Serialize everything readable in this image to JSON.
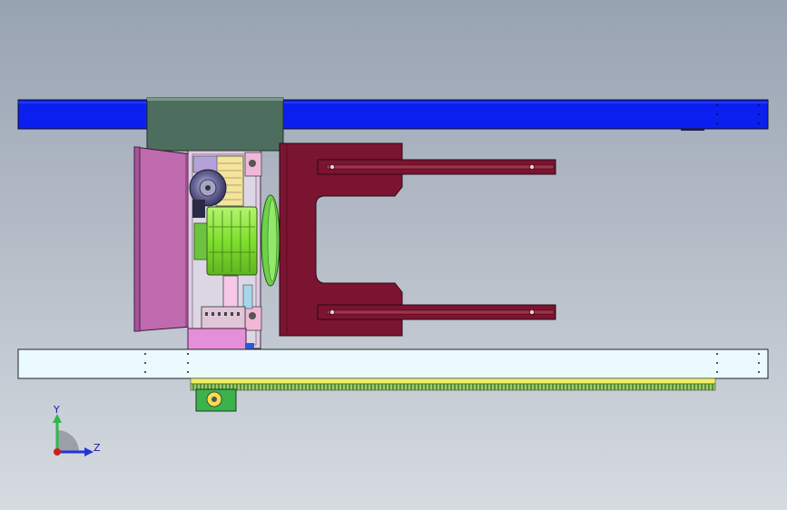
{
  "viewport": {
    "background_top": "#98a3b2",
    "background_bottom": "#d6dbe1"
  },
  "model": {
    "colors": {
      "top_beam": "#0a1ff0",
      "bottom_beam": "#eafafd",
      "carriage_dark_green": "#4d6e5e",
      "hopper": "#c06ab0",
      "gearbox": "#8fe83f",
      "motor": "#5b5a88",
      "fork_plate": "#7b1430",
      "flange": "#6ed14a",
      "rack": "#f1ef62",
      "rack_teeth": "#6ea24a",
      "small_drive": "#3cb24a",
      "pink_block": "#e58fd8"
    }
  },
  "triad": {
    "y_label": "Y",
    "z_label": "Z",
    "y_axis_color": "#2fb84a",
    "z_axis_color": "#2534d8",
    "origin_color": "#d01e1e"
  }
}
